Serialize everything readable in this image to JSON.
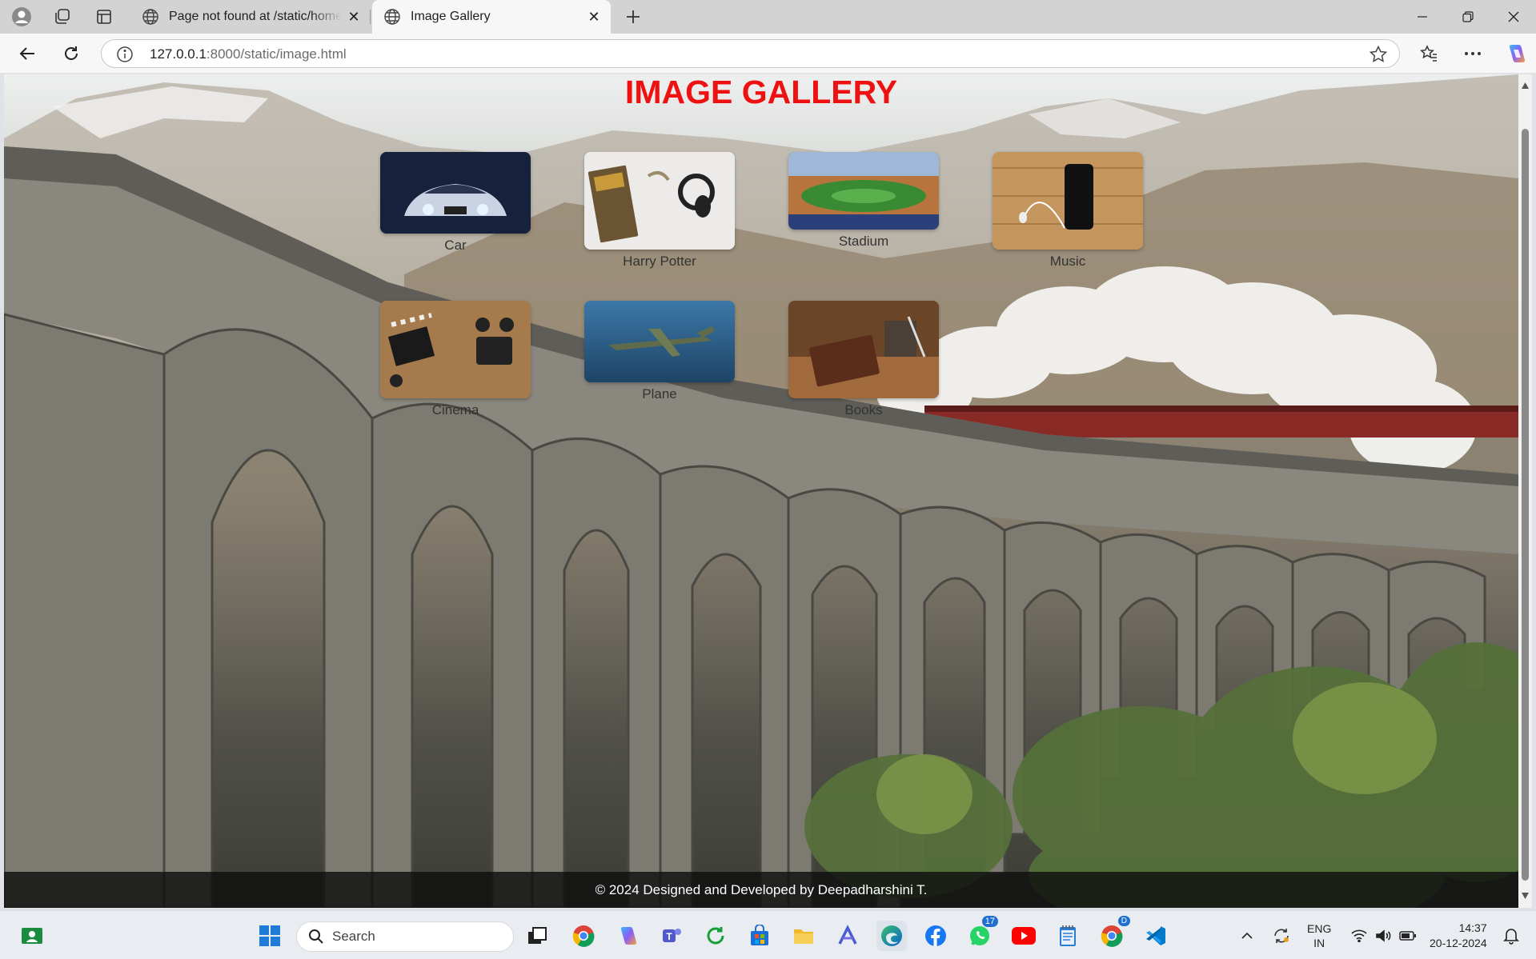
{
  "browser": {
    "tabs": [
      {
        "title": "Page not found at /static/home.html"
      },
      {
        "title": "Image Gallery"
      }
    ],
    "url_host": "127.0.0.1",
    "url_path": ":8000/static/image.html"
  },
  "page": {
    "heading": "IMAGE GALLERY",
    "gallery": [
      {
        "label": "Car"
      },
      {
        "label": "Harry Potter"
      },
      {
        "label": "Stadium"
      },
      {
        "label": "Music"
      },
      {
        "label": "Cinema"
      },
      {
        "label": "Plane"
      },
      {
        "label": "Books"
      }
    ],
    "footer": "© 2024 Designed and Developed by Deepadharshini T."
  },
  "taskbar": {
    "search_placeholder": "Search",
    "whatsapp_badge": "17",
    "chrome_badge": "D",
    "lang_top": "ENG",
    "lang_bottom": "IN",
    "time": "14:37",
    "date": "20-12-2024"
  },
  "colors": {
    "heading": "#ee1111",
    "tabstrip": "#d3d3d3",
    "taskbar": "#e9edf2"
  }
}
